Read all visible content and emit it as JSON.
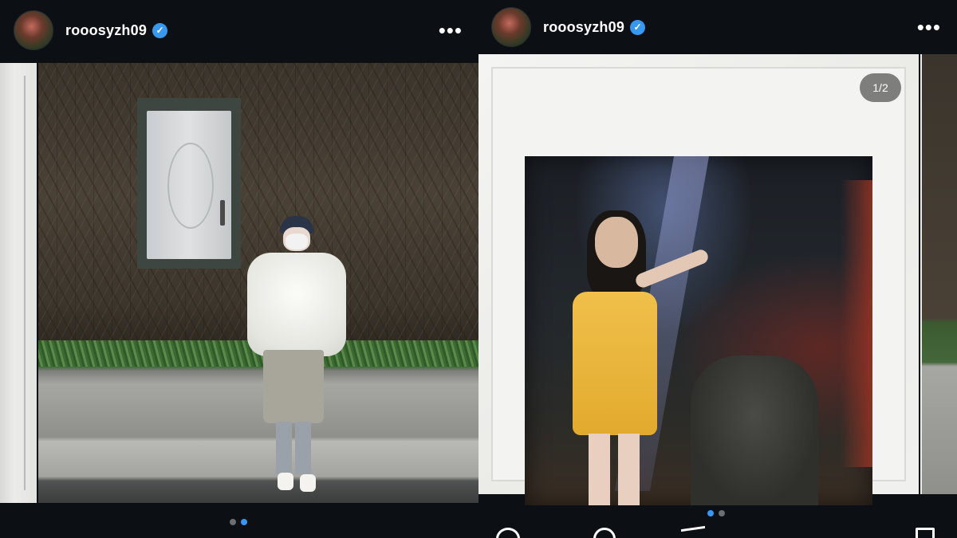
{
  "posts": [
    {
      "username": "rooosyzh09",
      "verified_badge": "✓",
      "more_label": "•••",
      "carousel": {
        "total": 2,
        "active_index": 2
      }
    },
    {
      "username": "rooosyzh09",
      "verified_badge": "✓",
      "more_label": "•••",
      "counter": "1/2",
      "carousel": {
        "total": 2,
        "active_index": 1
      },
      "actions": [
        "heart-icon",
        "comment-icon",
        "share-icon",
        "bookmark-icon"
      ]
    }
  ],
  "colors": {
    "background": "#0c1014",
    "verified": "#3897f0",
    "dot_active": "#3897f0",
    "dot_inactive": "#6b6f73"
  }
}
